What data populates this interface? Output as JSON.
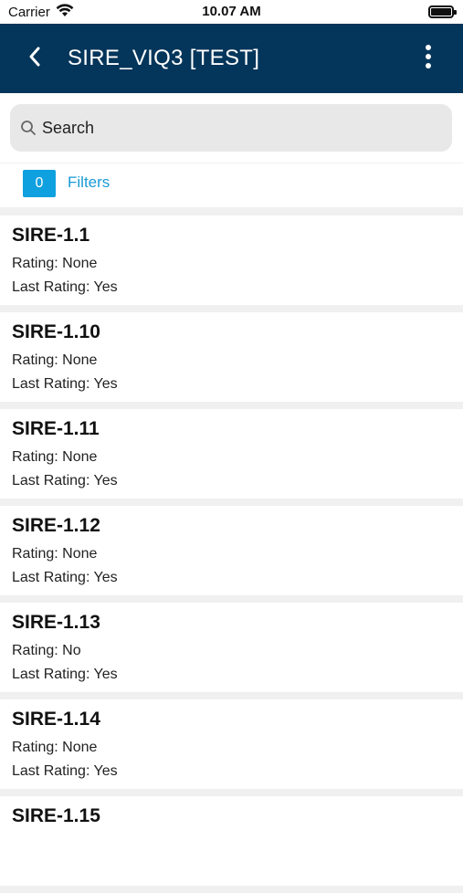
{
  "status_bar": {
    "carrier": "Carrier",
    "time": "10.07 AM"
  },
  "header": {
    "title": "SIRE_VIQ3 [TEST]",
    "background_color": "#04355a"
  },
  "search": {
    "placeholder": "Search"
  },
  "filters": {
    "count": "0",
    "label": "Filters",
    "accent_color": "#0fa0e0"
  },
  "items": [
    {
      "title": "SIRE-1.1",
      "rating": "Rating: None",
      "last_rating": "Last Rating: Yes"
    },
    {
      "title": "SIRE-1.10",
      "rating": "Rating: None",
      "last_rating": "Last Rating: Yes"
    },
    {
      "title": "SIRE-1.11",
      "rating": "Rating: None",
      "last_rating": "Last Rating: Yes"
    },
    {
      "title": "SIRE-1.12",
      "rating": "Rating: None",
      "last_rating": "Last Rating: Yes"
    },
    {
      "title": "SIRE-1.13",
      "rating": "Rating: No",
      "last_rating": "Last Rating: Yes"
    },
    {
      "title": "SIRE-1.14",
      "rating": "Rating: None",
      "last_rating": "Last Rating: Yes"
    },
    {
      "title": "SIRE-1.15",
      "rating": "",
      "last_rating": ""
    }
  ]
}
